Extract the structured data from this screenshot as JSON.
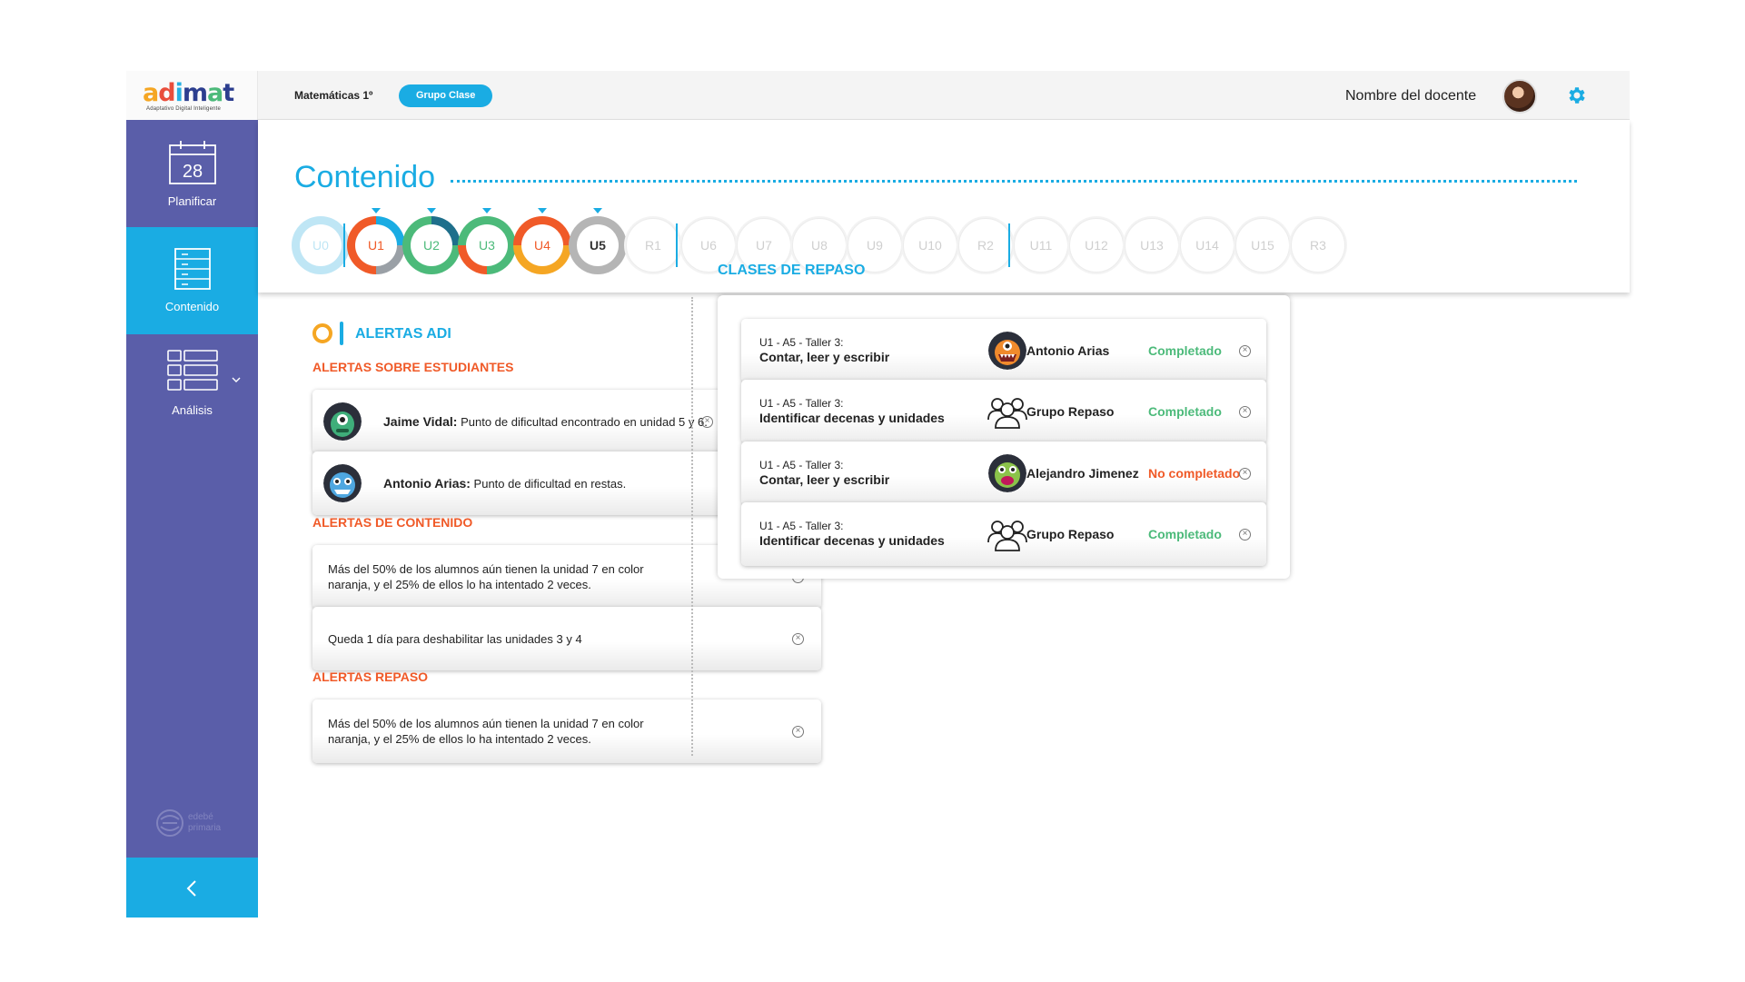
{
  "header": {
    "logo": "adimat",
    "logo_subtitle": "Adaptativo Digital Inteligente",
    "subject": "Matemáticas 1º",
    "group": "Grupo Clase",
    "teacher": "Nombre del docente"
  },
  "sidebar": {
    "items": [
      {
        "label": "Planificar",
        "icon": "calendar-icon",
        "day": "28",
        "active": false
      },
      {
        "label": "Contenido",
        "icon": "document-stack-icon",
        "active": true
      },
      {
        "label": "Análisis",
        "icon": "table-grid-icon",
        "active": false
      }
    ],
    "footer_logo": [
      "edebé",
      "primaria"
    ]
  },
  "content": {
    "title": "Contenido",
    "units": [
      {
        "label": "U0",
        "state": "faded",
        "colors": [
          "#bfe6f5",
          "#bfe6f5",
          "#bfe6f5",
          "#bfe6f5"
        ]
      },
      {
        "label": "U1",
        "state": "active",
        "caret": true,
        "colors": [
          "#1aace3",
          "#9aa0a6",
          "#f05a28",
          "#f05a28"
        ]
      },
      {
        "label": "U2",
        "state": "active",
        "caret": true,
        "colors": [
          "#1f6f8b",
          "#4cba7a",
          "#4cba7a",
          "#4cba7a"
        ]
      },
      {
        "label": "U3",
        "state": "active",
        "caret": true,
        "colors": [
          "#4cba7a",
          "#4cba7a",
          "#f05a28",
          "#4cba7a"
        ]
      },
      {
        "label": "U4",
        "state": "active",
        "caret": true,
        "colors": [
          "#f05a28",
          "#f5a623",
          "#f5a623",
          "#f05a28"
        ]
      },
      {
        "label": "U5",
        "state": "current",
        "caret": true,
        "colors": [
          "#b5b5b5",
          "#b5b5b5",
          "#b5b5b5",
          "#b5b5b5"
        ]
      },
      {
        "label": "R1",
        "state": "disabled"
      },
      {
        "label": "U6",
        "state": "disabled"
      },
      {
        "label": "U7",
        "state": "disabled"
      },
      {
        "label": "U8",
        "state": "disabled"
      },
      {
        "label": "U9",
        "state": "disabled"
      },
      {
        "label": "U10",
        "state": "disabled"
      },
      {
        "label": "R2",
        "state": "disabled"
      },
      {
        "label": "U11",
        "state": "disabled"
      },
      {
        "label": "U12",
        "state": "disabled"
      },
      {
        "label": "U13",
        "state": "disabled"
      },
      {
        "label": "U14",
        "state": "disabled"
      },
      {
        "label": "U15",
        "state": "disabled"
      },
      {
        "label": "R3",
        "state": "disabled"
      }
    ]
  },
  "alerts": {
    "title": "ALERTAS ADI",
    "students_label": "ALERTAS SOBRE ESTUDIANTES",
    "students": [
      {
        "name": "Jaime Vidal:",
        "text": "Punto de dificultad encontrado en unidad 5 y 6.",
        "avatar": "green-monster-avatar"
      },
      {
        "name": "Antonio Arias:",
        "text": "Punto de dificultad en restas.",
        "avatar": "blue-monster-avatar"
      }
    ],
    "content_label": "ALERTAS DE CONTENIDO",
    "content": [
      {
        "line1": "Más del 50% de los alumnos aún tienen la unidad 7 en color",
        "line2": "naranja, y el 25% de ellos lo ha intentado 2 veces."
      },
      {
        "line1": "Queda 1 día para deshabilitar las unidades 3 y 4",
        "line2": ""
      }
    ],
    "review_label": "ALERTAS REPASO",
    "review": [
      {
        "line1": "Más del 50% de los alumnos aún tienen la unidad 7 en color",
        "line2": "naranja, y el 25% de ellos lo ha intentado 2 veces."
      }
    ]
  },
  "repaso": {
    "title": "CLASES DE REPASO",
    "rows": [
      {
        "code": "U1 - A5 - Taller 3:",
        "name": "Contar, leer y escribir",
        "who": "Antonio Arias",
        "who_type": "avatar",
        "status": "Completado",
        "ok": true
      },
      {
        "code": "U1 - A5 - Taller 3:",
        "name": "Identificar decenas y unidades",
        "who": "Grupo Repaso",
        "who_type": "group",
        "status": "Completado",
        "ok": true
      },
      {
        "code": "U1 - A5 - Taller 3:",
        "name": "Contar, leer y escribir",
        "who": "Alejandro Jimenez",
        "who_type": "avatar",
        "status": "No completado",
        "ok": false
      },
      {
        "code": "U1 - A5 - Taller 3:",
        "name": "Identificar decenas y unidades",
        "who": "Grupo Repaso",
        "who_type": "group",
        "status": "Completado",
        "ok": true
      }
    ]
  },
  "colors": {
    "accent": "#1aace3",
    "sidebar": "#5a5ea9",
    "alert_orange": "#f05a28",
    "success": "#4cba7a"
  }
}
